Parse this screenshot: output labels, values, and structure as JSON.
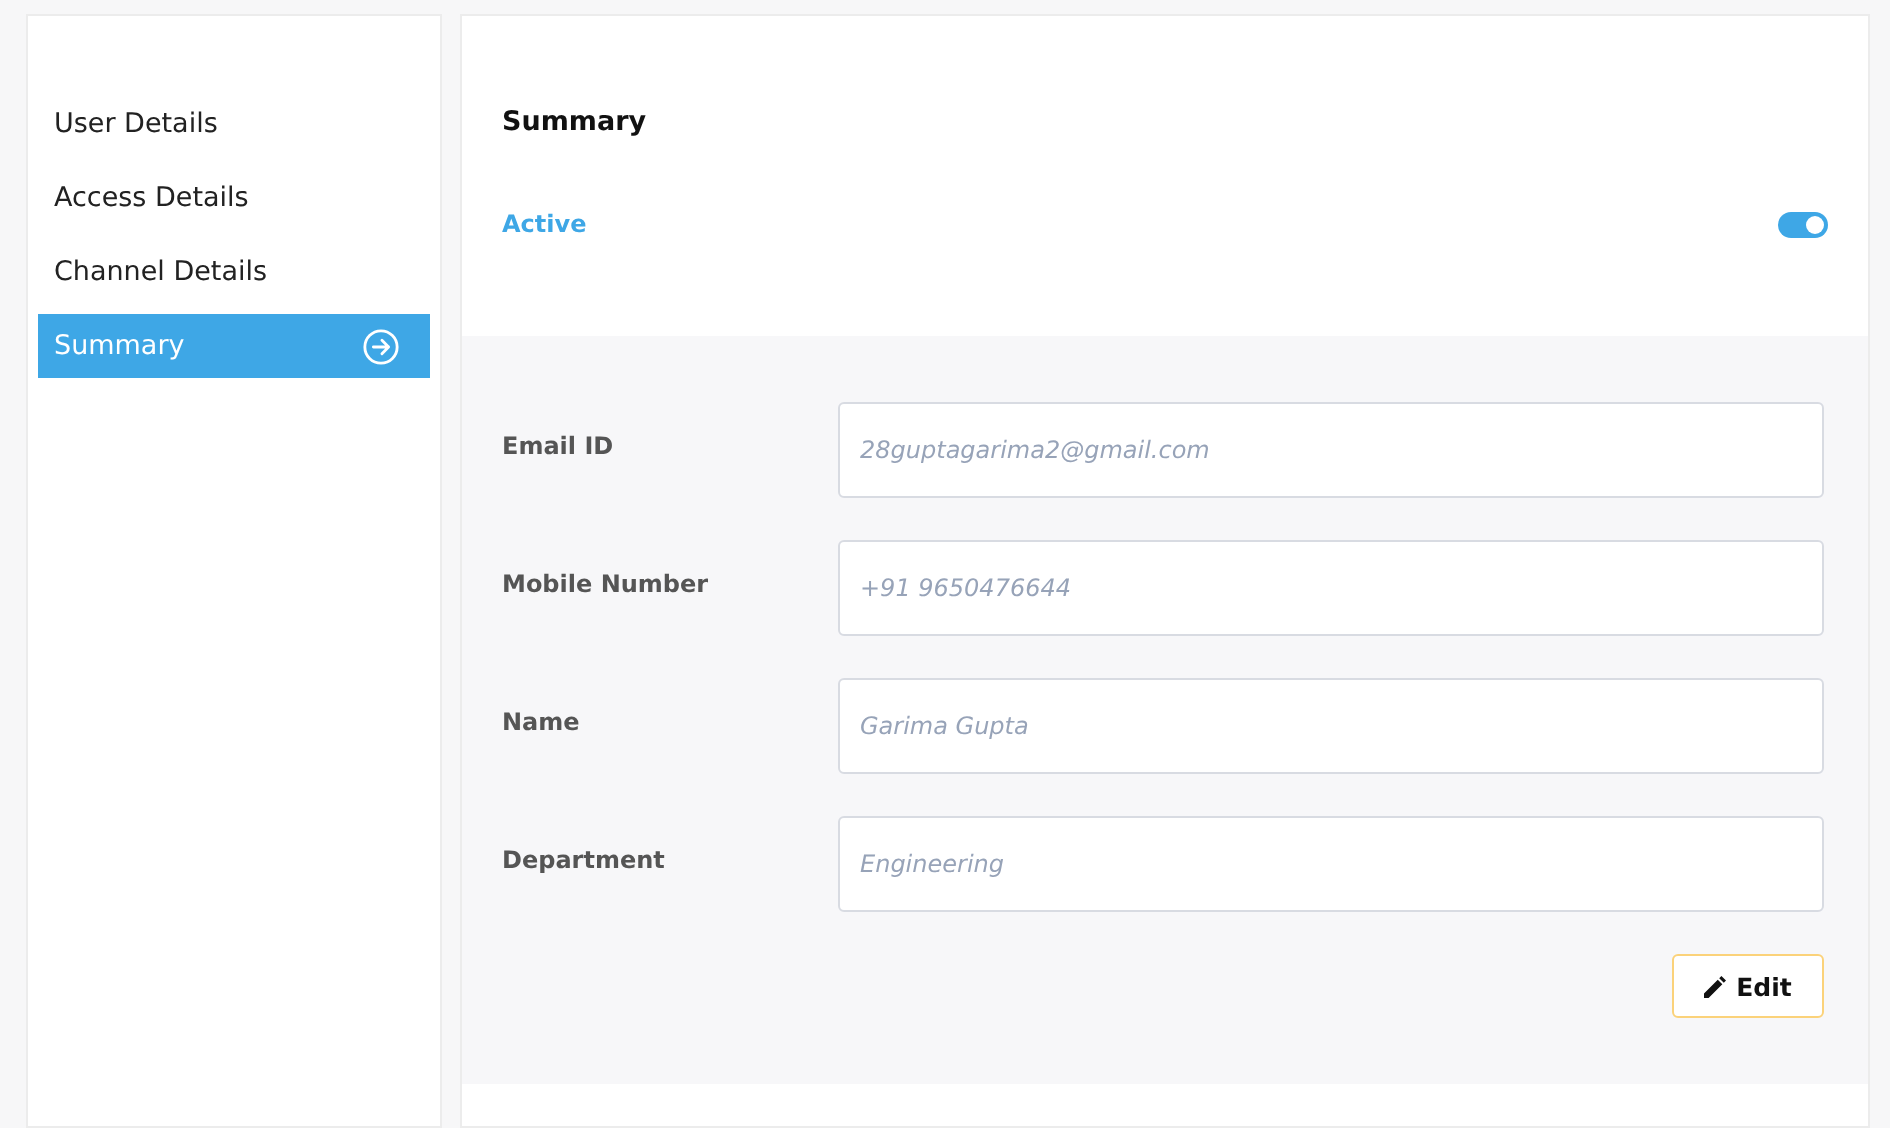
{
  "sidebar": {
    "items": [
      {
        "label": "User Details",
        "selected": false
      },
      {
        "label": "Access Details",
        "selected": false
      },
      {
        "label": "Channel Details",
        "selected": false
      },
      {
        "label": "Summary",
        "selected": true
      }
    ]
  },
  "summary": {
    "title": "Summary",
    "status_label": "Active",
    "active": true
  },
  "fields": [
    {
      "label": "Email ID",
      "placeholder": "28guptagarima2@gmail.com"
    },
    {
      "label": "Mobile Number",
      "placeholder": "+91 9650476644"
    },
    {
      "label": "Name",
      "placeholder": "Garima Gupta"
    },
    {
      "label": "Department",
      "placeholder": "Engineering"
    }
  ],
  "edit_button": {
    "label": "Edit"
  }
}
